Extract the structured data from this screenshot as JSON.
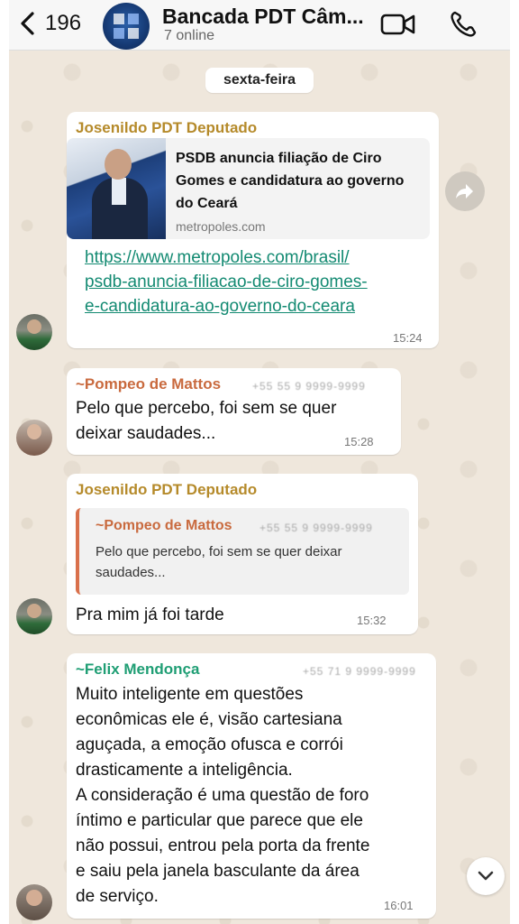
{
  "header": {
    "back_count": "196",
    "title": "Bancada PDT Câm...",
    "subtitle": "7 online",
    "icons": {
      "back": "chevron-left-icon",
      "video": "video-camera-icon",
      "call": "phone-icon"
    }
  },
  "date_chip": "sexta-feira",
  "messages": [
    {
      "sender": "Josenildo PDT Deputado",
      "sender_color": "#b58a2a",
      "preview": {
        "title": "PSDB anuncia filiação de Ciro Gomes e candidatura ao governo do Ceará",
        "domain": "metropoles.com"
      },
      "link_lines": [
        "https://www.metropoles.com/brasil/",
        "psdb-anuncia-filiacao-de-ciro-gomes-",
        "e-candidatura-ao-governo-do-ceara"
      ],
      "time": "15:24"
    },
    {
      "sender": "~Pompeo de Mattos",
      "sender_color": "#c96a3e",
      "phone": "+55 55 9 9999-9999",
      "lines": [
        "Pelo que percebo, foi sem se quer",
        "deixar  saudades..."
      ],
      "time": "15:28"
    },
    {
      "sender": "Josenildo PDT Deputado",
      "sender_color": "#b58a2a",
      "quote": {
        "name": "~Pompeo de Mattos",
        "phone": "+55 55 9 9999-9999",
        "text": "Pelo que percebo, foi sem se quer deixar saudades..."
      },
      "lines": [
        "Pra mim já foi tarde"
      ],
      "time": "15:32"
    },
    {
      "sender": "~Felix Mendonça",
      "sender_color": "#1f9e74",
      "phone": "+55 71 9 9999-9999",
      "lines": [
        "Muito inteligente em questões",
        "econômicas ele é, visão cartesiana",
        "aguçada, a emoção ofusca e corrói",
        "drasticamente a inteligência.",
        "A consideração é uma questão de foro",
        "íntimo e particular que parece que ele",
        "não possui, entrou pela porta da frente",
        "e saiu pela janela basculante da área",
        "de serviço."
      ],
      "time": "16:01"
    }
  ],
  "buttons": {
    "forward": "forward-arrow-icon",
    "scroll_down": "chevron-down-icon"
  }
}
